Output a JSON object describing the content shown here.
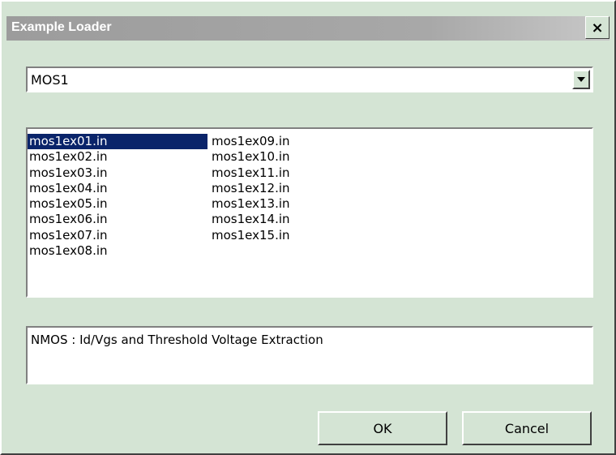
{
  "window": {
    "title": "Example Loader",
    "close_symbol": "×",
    "close_icon": "close-icon"
  },
  "category_select": {
    "selected": "MOS1"
  },
  "examples": {
    "column1": [
      "mos1ex01.in",
      "mos1ex02.in",
      "mos1ex03.in",
      "mos1ex04.in",
      "mos1ex05.in",
      "mos1ex06.in",
      "mos1ex07.in",
      "mos1ex08.in"
    ],
    "column2": [
      "mos1ex09.in",
      "mos1ex10.in",
      "mos1ex11.in",
      "mos1ex12.in",
      "mos1ex13.in",
      "mos1ex14.in",
      "mos1ex15.in"
    ],
    "selected": "mos1ex01.in"
  },
  "description": {
    "text": "NMOS : Id/Vgs and Threshold Voltage Extraction"
  },
  "buttons": {
    "ok_label": "OK",
    "cancel_label": "Cancel"
  },
  "colors": {
    "dialog_bg": "#d4e4d4",
    "selection_bg": "#0a246a",
    "selection_fg": "#ffffff"
  }
}
